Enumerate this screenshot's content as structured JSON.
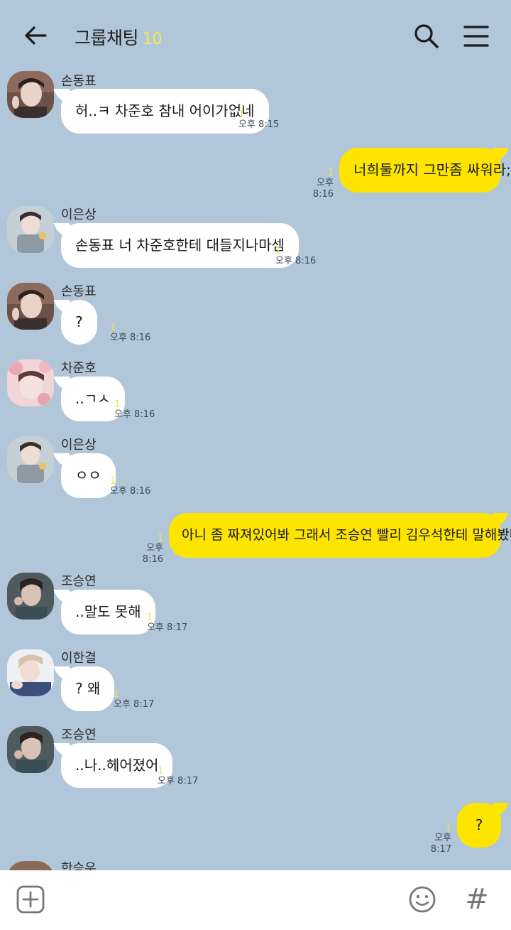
{
  "header": {
    "title": "그룹채팅",
    "member_count": "10"
  },
  "messages": [
    {
      "sender": "손동표",
      "text": "허..ㅋ 차준호 참내 어이가없네",
      "unread": "1",
      "time": "오후 8:15"
    },
    {
      "sender": "",
      "text": "너희둘까지 그만좀 싸워라;;",
      "unread": "1",
      "time": "오후 8:16"
    },
    {
      "sender": "이은상",
      "text": "손동표 너 차준호한테 대들지나마셈",
      "unread": "1",
      "time": "오후 8:16"
    },
    {
      "sender": "손동표",
      "text": "?",
      "unread": "1",
      "time": "오후 8:16"
    },
    {
      "sender": "차준호",
      "text": "..ㄱㅅ",
      "unread": "1",
      "time": "오후 8:16"
    },
    {
      "sender": "이은상",
      "text": "ㅇㅇ",
      "unread": "1",
      "time": "오후 8:16"
    },
    {
      "sender": "",
      "text": "아니 좀 짜져있어봐 그래서 조승연 빨리 김우석한테 말해봤냐",
      "unread": "1",
      "time": "오후 8:16"
    },
    {
      "sender": "조승연",
      "text": "..말도 못해",
      "unread": "1",
      "time": "오후 8:17"
    },
    {
      "sender": "이한결",
      "text": "? 왜",
      "unread": "1",
      "time": "오후 8:17"
    },
    {
      "sender": "조승연",
      "text": "..나..헤어졌어",
      "unread": "1",
      "time": "오후 8:17"
    },
    {
      "sender": "",
      "text": "?",
      "unread": "1",
      "time": "오후 8:17"
    },
    {
      "sender": "한승우",
      "text": "",
      "unread": "",
      "time": ""
    }
  ],
  "colors": {
    "background": "#b2c6d9",
    "my_bubble": "#fee500",
    "other_bubble": "#ffffff",
    "unread": "#f1e44a"
  }
}
